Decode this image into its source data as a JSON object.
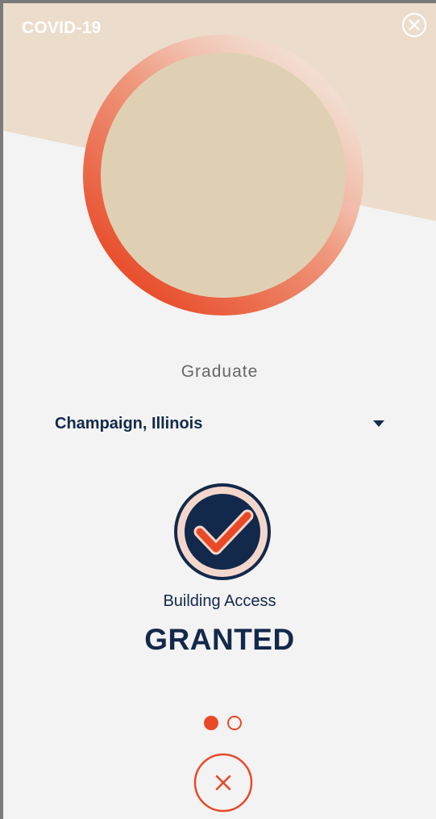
{
  "header": {
    "title": "COVID-19",
    "close_icon": "close-circle-icon"
  },
  "profile": {
    "avatar": "user-photo-placeholder",
    "role": "Graduate"
  },
  "location": {
    "selected": "Champaign, Illinois",
    "icon": "caret-down-icon"
  },
  "status": {
    "icon": "checkmark-icon",
    "label": "Building Access",
    "value": "GRANTED"
  },
  "pager": {
    "active_page": 1,
    "total_pages": 2
  },
  "colors": {
    "accent": "#e84a27",
    "navy": "#13294b",
    "band": "#ecdccb",
    "avatar_fill": "#e0d0b3",
    "background": "#f3f3f3"
  }
}
